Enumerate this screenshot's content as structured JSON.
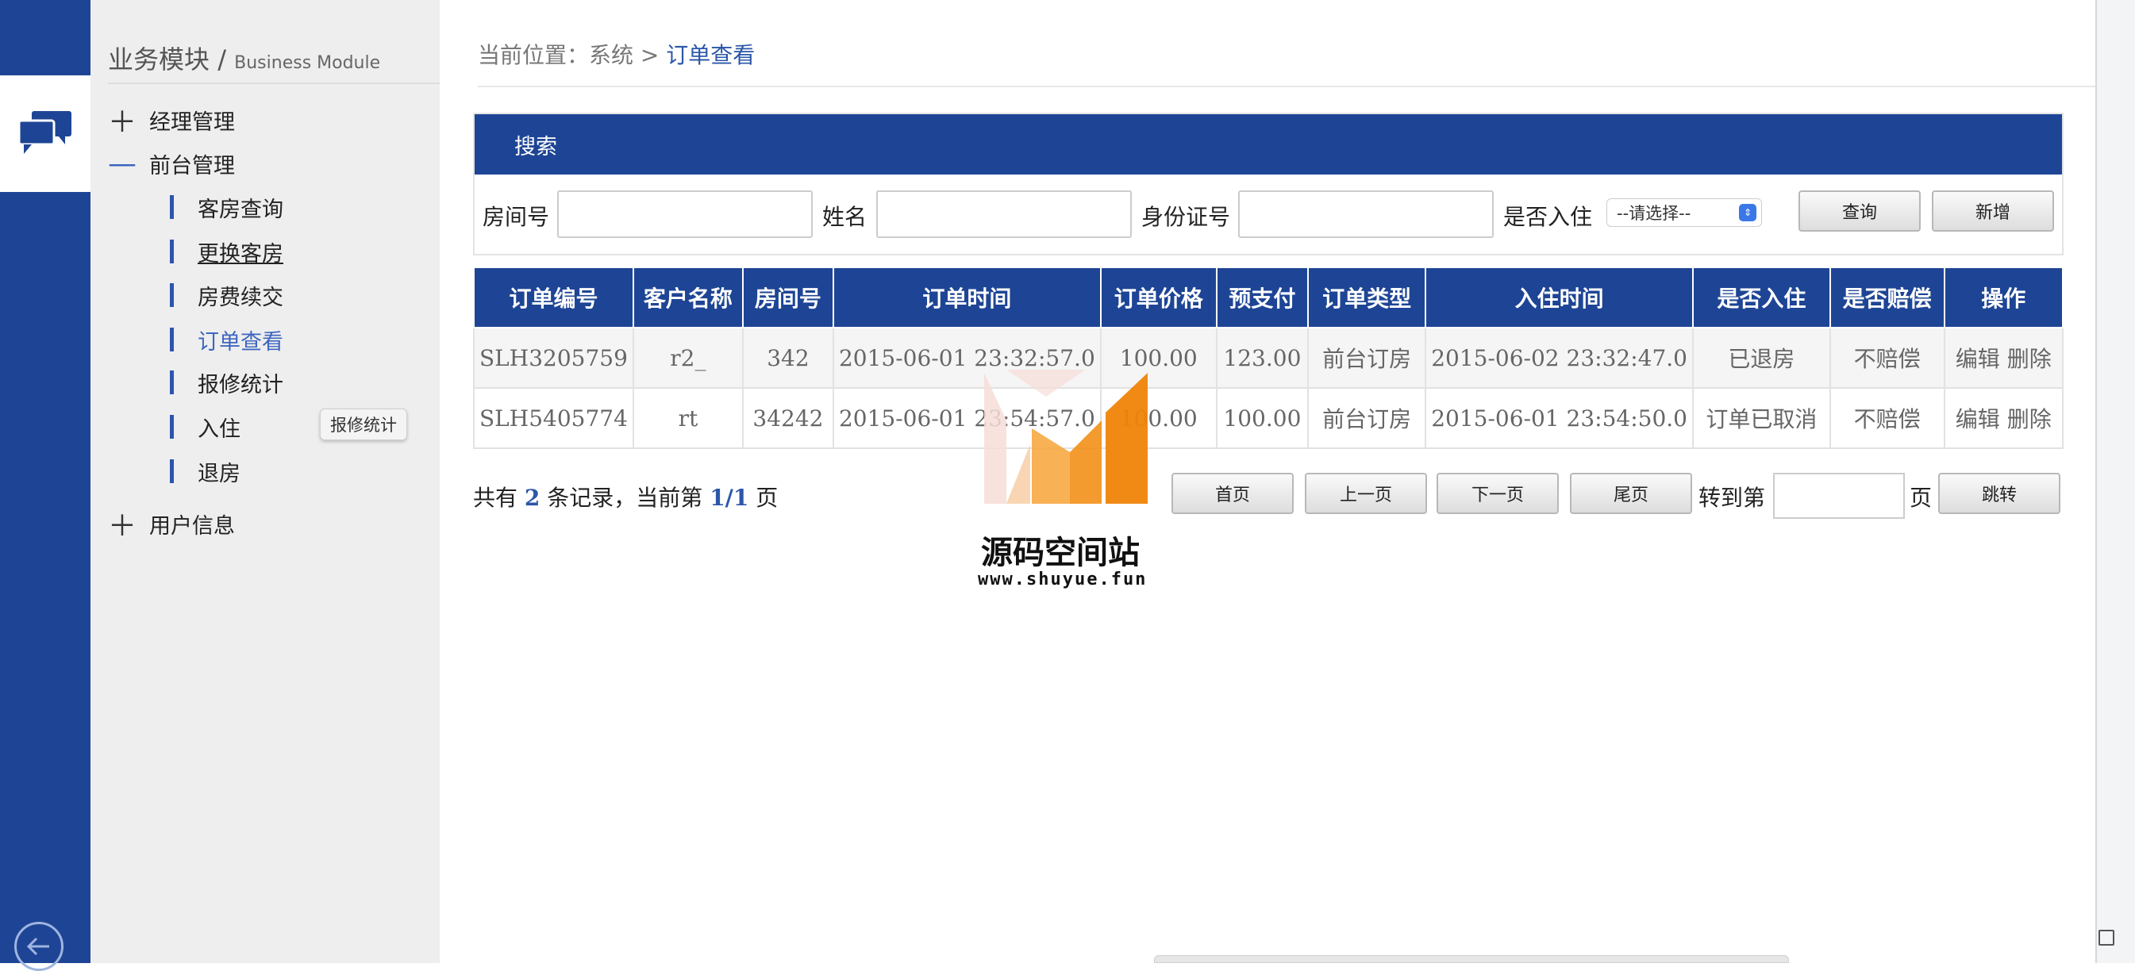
{
  "sidebar": {
    "title_cn": "业务模块",
    "title_sep": " / ",
    "title_en": "Business Module",
    "groups": [
      {
        "sign": "＋",
        "label": "经理管理"
      },
      {
        "sign": "—",
        "label": "前台管理"
      },
      {
        "sign": "＋",
        "label": "用户信息"
      }
    ],
    "items": [
      {
        "label": "客房查询"
      },
      {
        "label": "更换客房"
      },
      {
        "label": "房费续交"
      },
      {
        "label": "订单查看"
      },
      {
        "label": "报修统计"
      },
      {
        "label": "入住"
      },
      {
        "label": "退房"
      }
    ],
    "tooltip": "报修统计"
  },
  "breadcrumb": {
    "prefix": "当前位置：系统 > ",
    "current": "订单查看"
  },
  "search": {
    "title": "搜索",
    "room_label": "房间号",
    "name_label": "姓名",
    "id_label": "身份证号",
    "checkin_label": "是否入住",
    "checkin_selected": "--请选择--",
    "query_button": "查询",
    "add_button": "新增"
  },
  "table": {
    "headers": [
      "订单编号",
      "客户名称",
      "房间号",
      "订单时间",
      "订单价格",
      "预支付",
      "订单类型",
      "入住时间",
      "是否入住",
      "是否赔偿",
      "操作"
    ],
    "rows": [
      [
        "SLH3205759",
        "r2_",
        "342",
        "2015-06-01 23:32:57.0",
        "100.00",
        "123.00",
        "前台订房",
        "2015-06-02 23:32:47.0",
        "已退房",
        "不赔偿"
      ],
      [
        "SLH5405774",
        "rt",
        "34242",
        "2015-06-01 23:54:57.0",
        "100.00",
        "100.00",
        "前台订房",
        "2015-06-01 23:54:50.0",
        "订单已取消",
        "不赔偿"
      ]
    ],
    "edit_label": "编辑",
    "delete_label": "删除"
  },
  "pager": {
    "total_prefix": "共有 ",
    "total": "2",
    "total_mid": " 条记录，当前第 ",
    "page": "1/1",
    "total_suffix": " 页",
    "first": "首页",
    "prev": "上一页",
    "next": "下一页",
    "last": "尾页",
    "goto_label": "转到第",
    "page_label": "页",
    "jump": "跳转"
  },
  "watermark": {
    "title": "源码空间站",
    "url": "www.shuyue.fun"
  },
  "colors": {
    "primary": "#1e4595",
    "active_link": "#3d66c0"
  }
}
